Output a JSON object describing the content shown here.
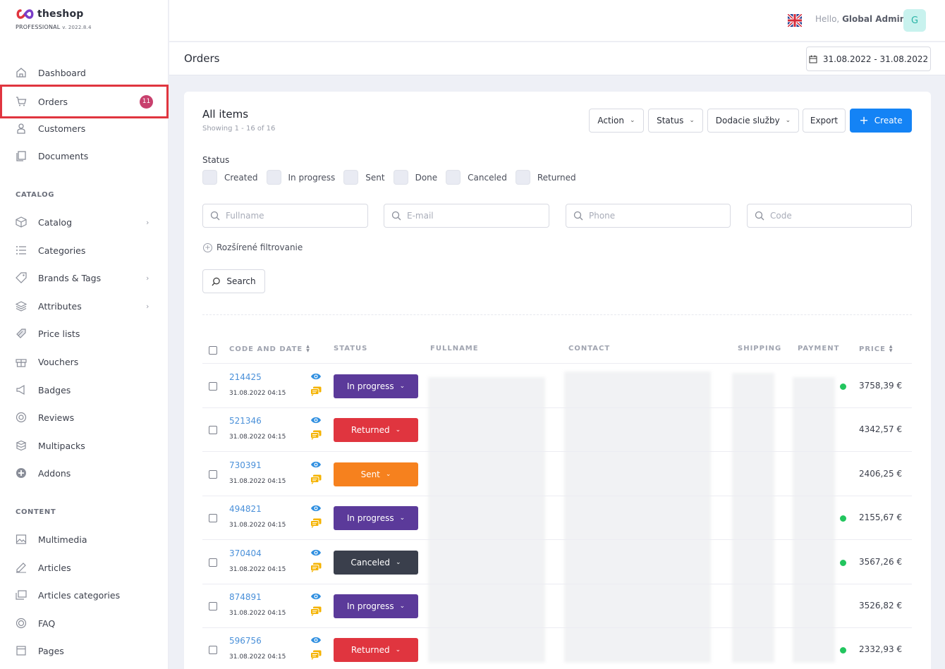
{
  "brand": {
    "name": "theshop",
    "edition": "PROFESSIONAL",
    "version": "v. 2022.8.4"
  },
  "sidebar": {
    "items": [
      {
        "label": "Dashboard",
        "icon": "home-icon"
      },
      {
        "label": "Orders",
        "icon": "cart-icon",
        "badge": "11",
        "active": true
      },
      {
        "label": "Customers",
        "icon": "user-icon"
      },
      {
        "label": "Documents",
        "icon": "documents-icon"
      }
    ],
    "catalog_section": "CATALOG",
    "catalog_items": [
      {
        "label": "Catalog",
        "icon": "box-icon",
        "chevron": true
      },
      {
        "label": "Categories",
        "icon": "list-icon"
      },
      {
        "label": "Brands & Tags",
        "icon": "tag-icon",
        "chevron": true
      },
      {
        "label": "Attributes",
        "icon": "layers-icon",
        "chevron": true
      },
      {
        "label": "Price lists",
        "icon": "price-icon"
      },
      {
        "label": "Vouchers",
        "icon": "gift-icon"
      },
      {
        "label": "Badges",
        "icon": "megaphone-icon"
      },
      {
        "label": "Reviews",
        "icon": "reviews-icon"
      },
      {
        "label": "Multipacks",
        "icon": "multipack-icon"
      },
      {
        "label": "Addons",
        "icon": "plus-circle-icon"
      }
    ],
    "content_section": "CONTENT",
    "content_items": [
      {
        "label": "Multimedia",
        "icon": "image-icon"
      },
      {
        "label": "Articles",
        "icon": "edit-icon"
      },
      {
        "label": "Articles categories",
        "icon": "folders-icon"
      },
      {
        "label": "FAQ",
        "icon": "faq-icon"
      },
      {
        "label": "Pages",
        "icon": "page-icon"
      }
    ]
  },
  "header": {
    "hello": "Hello,",
    "user": "Global Admin",
    "avatar": "G"
  },
  "subheader": {
    "title": "Orders",
    "date_range": "31.08.2022 - 31.08.2022"
  },
  "card": {
    "title": "All items",
    "subtitle": "Showing 1 - 16 of 16",
    "buttons": {
      "action": "Action",
      "status": "Status",
      "delivery": "Dodacie služby",
      "export": "Export",
      "create": "Create"
    },
    "status_label": "Status",
    "status_filters": [
      "Created",
      "In progress",
      "Sent",
      "Done",
      "Canceled",
      "Returned"
    ],
    "search_fields": [
      {
        "placeholder": "Fullname",
        "value": ""
      },
      {
        "placeholder": "E-mail",
        "value": ""
      },
      {
        "placeholder": "Phone",
        "value": ""
      },
      {
        "placeholder": "Code",
        "value": ""
      }
    ],
    "advanced_filter": "Rozšírené filtrovanie",
    "search_button": "Search"
  },
  "table": {
    "columns": [
      "CODE AND DATE",
      "STATUS",
      "FULLNAME",
      "CONTACT",
      "SHIPPING",
      "PAYMENT",
      "PRICE"
    ],
    "rows": [
      {
        "code": "214425",
        "date": "31.08.2022 04:15",
        "status": "In progress",
        "color": "#5b3a9a",
        "paid": true,
        "price": "3758,39 €"
      },
      {
        "code": "521346",
        "date": "31.08.2022 04:15",
        "status": "Returned",
        "color": "#e0353f",
        "paid": false,
        "price": "4342,57 €"
      },
      {
        "code": "730391",
        "date": "31.08.2022 04:15",
        "status": "Sent",
        "color": "#f6811e",
        "paid": false,
        "price": "2406,25 €"
      },
      {
        "code": "494821",
        "date": "31.08.2022 04:15",
        "status": "In progress",
        "color": "#5b3a9a",
        "paid": true,
        "price": "2155,67 €"
      },
      {
        "code": "370404",
        "date": "31.08.2022 04:15",
        "status": "Canceled",
        "color": "#3a3f4c",
        "paid": true,
        "price": "3567,26 €"
      },
      {
        "code": "874891",
        "date": "31.08.2022 04:15",
        "status": "In progress",
        "color": "#5b3a9a",
        "paid": false,
        "price": "3526,82 €"
      },
      {
        "code": "596756",
        "date": "31.08.2022 04:15",
        "status": "Returned",
        "color": "#e0353f",
        "paid": true,
        "price": "2332,93 €"
      }
    ]
  },
  "colors": {
    "accent": "#1483f5",
    "active_border": "#e0353f",
    "badge": "#c8406d",
    "paid_dot": "#22c55e",
    "link": "#4a90d9"
  }
}
